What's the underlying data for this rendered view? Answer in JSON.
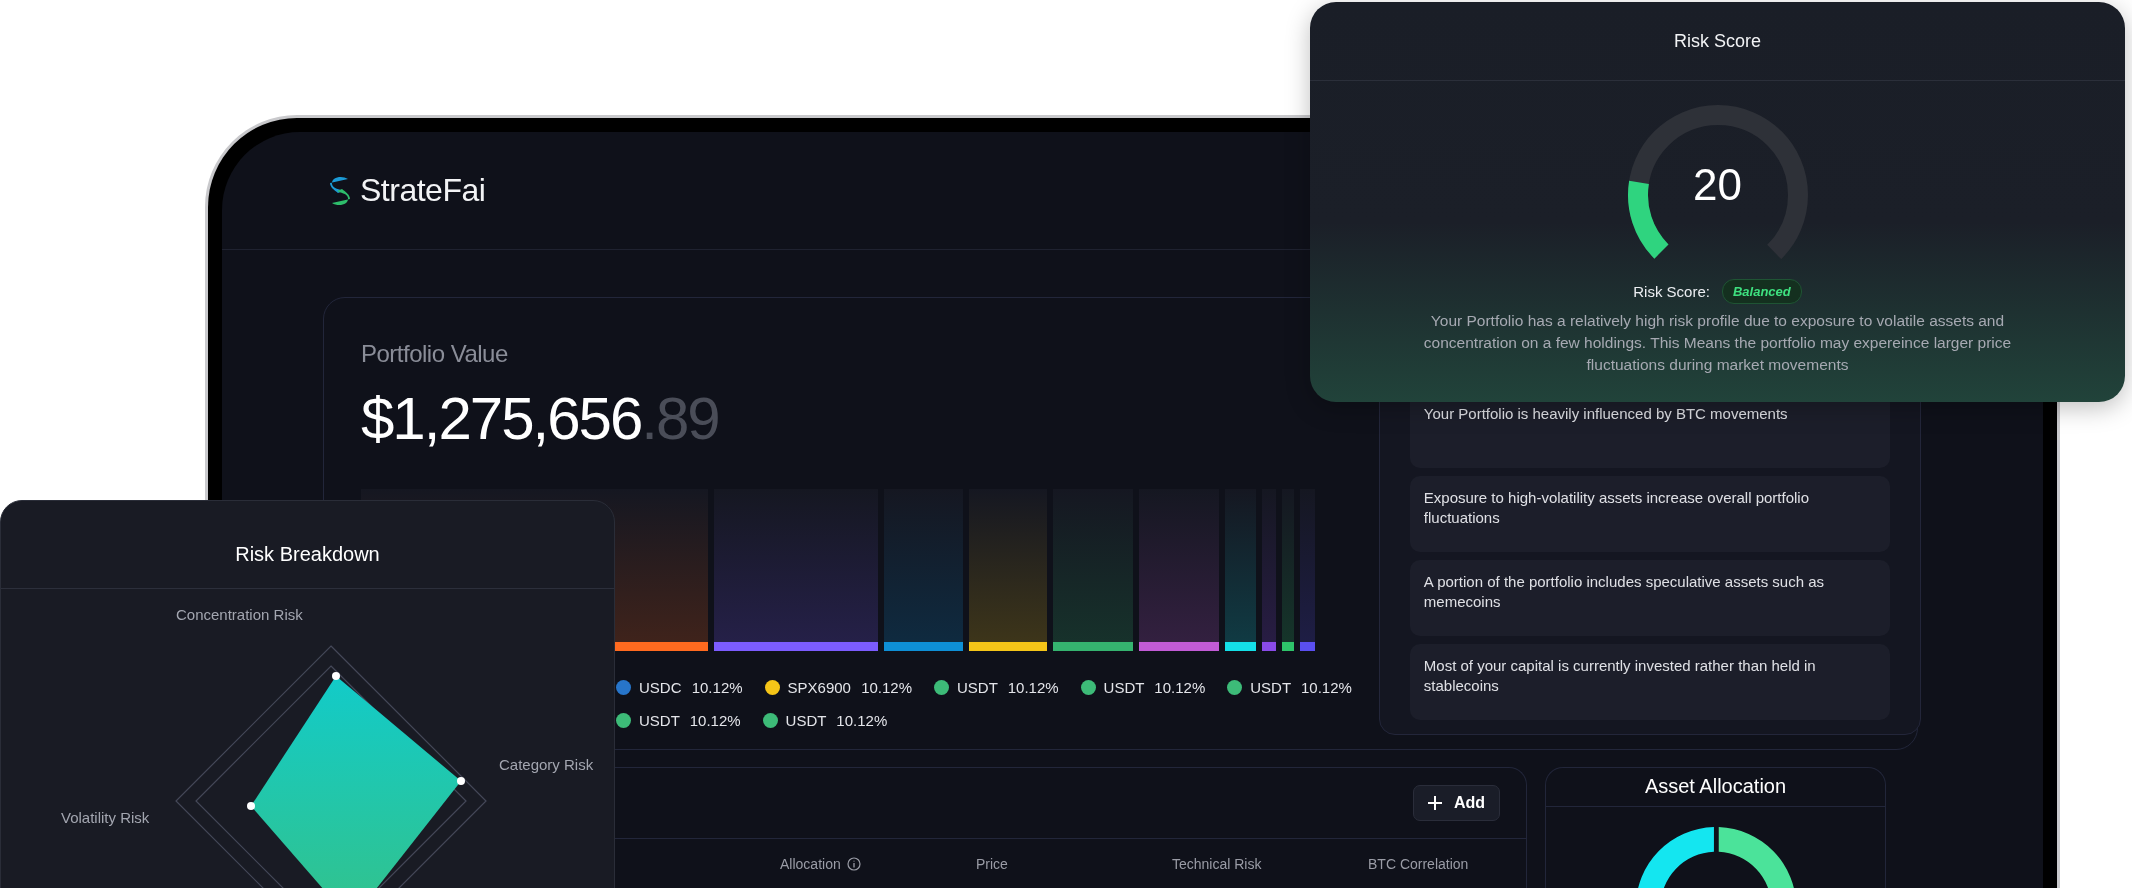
{
  "brand": {
    "name": "StrateFai"
  },
  "portfolio": {
    "label": "Portfolio Value",
    "value_main": "$1,275,656",
    "value_cents": ".89",
    "legend_rows": [
      [
        {
          "symbol": "USDC",
          "share": "10.12%",
          "color": "#2775ca"
        },
        {
          "symbol": "SPX6900",
          "share": "10.12%",
          "color": "#f5c518"
        },
        {
          "symbol": "USDT",
          "share": "10.12%",
          "color": "#3dbb78"
        },
        {
          "symbol": "USDT",
          "share": "10.12%",
          "color": "#3dbb78"
        },
        {
          "symbol": "USDT",
          "share": "10.12%",
          "color": "#3dbb78"
        }
      ],
      [
        {
          "symbol": "USDT",
          "share": "10.12%",
          "color": "#3dbb78"
        },
        {
          "symbol": "USDT",
          "share": "10.12%",
          "color": "#3dbb78"
        }
      ]
    ]
  },
  "insights": [
    "Your Portfolio is heavily influenced by BTC movements",
    "Exposure to high-volatility assets increase overall portfolio fluctuations",
    "A portion of the portfolio includes speculative assets such as memecoins",
    "Most of your capital is currently invested rather than held in stablecoins"
  ],
  "holdings": {
    "add_button": "Add",
    "columns": [
      {
        "label": "Allocation",
        "info": true
      },
      {
        "label": "Price",
        "info": false
      },
      {
        "label": "Technical Risk",
        "info": false
      },
      {
        "label": "BTC Correlation",
        "info": false
      }
    ]
  },
  "asset_allocation": {
    "title": "Asset Allocation"
  },
  "risk_score": {
    "title": "Risk Score",
    "score": "20",
    "level": 0.2,
    "label": "Risk Score:",
    "badge": "Balanced",
    "description": "Your Portfolio has a relatively high risk profile due to exposure to volatile assets and concentration on a few holdings. This Means the portfolio may expereince larger price fluctuations during market movements"
  },
  "risk_breakdown": {
    "title": "Risk Breakdown",
    "axes": [
      "Concentration Risk",
      "Category Risk",
      "Volatility Risk"
    ]
  }
}
